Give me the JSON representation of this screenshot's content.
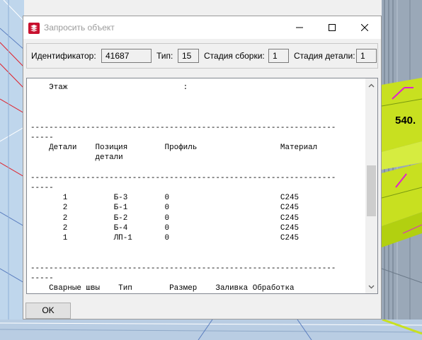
{
  "window": {
    "title": "Запросить объект",
    "icon": "tekla-app-icon",
    "minimize_icon": "minimize-icon",
    "maximize_icon": "maximize-icon",
    "close_icon": "close-icon"
  },
  "fields": {
    "id_label": "Идентификатор:",
    "id_value": "41687",
    "type_label": "Тип:",
    "type_value": "15",
    "assembly_stage_label": "Стадия сборки:",
    "assembly_stage_value": "1",
    "part_stage_label": "Стадия детали:",
    "part_stage_value": "1"
  },
  "report": {
    "lines": [
      "    Этаж                         :",
      "",
      "",
      "",
      "------------------------------------------------------------------",
      "-----",
      "    Детали    Позиция        Профиль                  Материал",
      "              детали",
      "",
      "------------------------------------------------------------------",
      "-----",
      "       1          Б-3        0                        C245",
      "       2          Б-1        0                        C245",
      "       2          Б-2        0                        C245",
      "       2          Б-4        0                        C245",
      "       1          ЛП-1       0                        C245",
      "",
      "",
      "------------------------------------------------------------------",
      "-----",
      "    Сварные швы    Тип        Размер    Заливка Обработка"
    ]
  },
  "buttons": {
    "ok": "OK"
  },
  "background": {
    "cad_label": "540."
  },
  "colors": {
    "title_text": "#9b9b9b",
    "titlebar_bg": "#ffffff",
    "dialog_bg": "#f0f0f0",
    "cad_line_red": "#e0202a",
    "cad_line_magenta": "#e020d0",
    "cad_yellow_green": "#c8e020"
  }
}
